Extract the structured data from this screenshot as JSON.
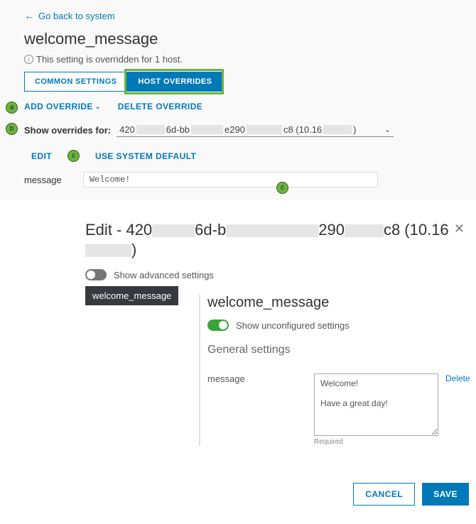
{
  "back_link": "Go back to system",
  "page_title": "welcome_message",
  "override_note": "This setting is overridden for 1 host.",
  "tabs": {
    "common": "COMMON SETTINGS",
    "host": "HOST OVERRIDES"
  },
  "actions": {
    "add_override": "ADD OVERRIDE",
    "delete_override": "DELETE OVERRIDE",
    "edit": "EDIT",
    "use_default": "USE SYSTEM DEFAULT"
  },
  "filter": {
    "label": "Show overrides for:",
    "value_parts": [
      "420",
      "6d-bb",
      "e290",
      "c8 (10.16",
      ")"
    ]
  },
  "field": {
    "label": "message",
    "value": "Welcome!"
  },
  "callouts": {
    "a": "a",
    "b": "b",
    "c1": "c",
    "c2": "c"
  },
  "modal": {
    "title_parts": [
      "Edit - 420",
      "6d-b",
      "290",
      "c8 (10.16",
      ")"
    ],
    "adv_toggle_label": "Show advanced settings",
    "side_tab": "welcome_message",
    "body_title": "welcome_message",
    "uncfg_label": "Show unconfigured settings",
    "section": "General settings",
    "msg_label": "message",
    "msg_value": "Welcome!\n\nHave a great day!",
    "delete": "Delete",
    "required": "Required",
    "cancel": "CANCEL",
    "save": "SAVE"
  }
}
